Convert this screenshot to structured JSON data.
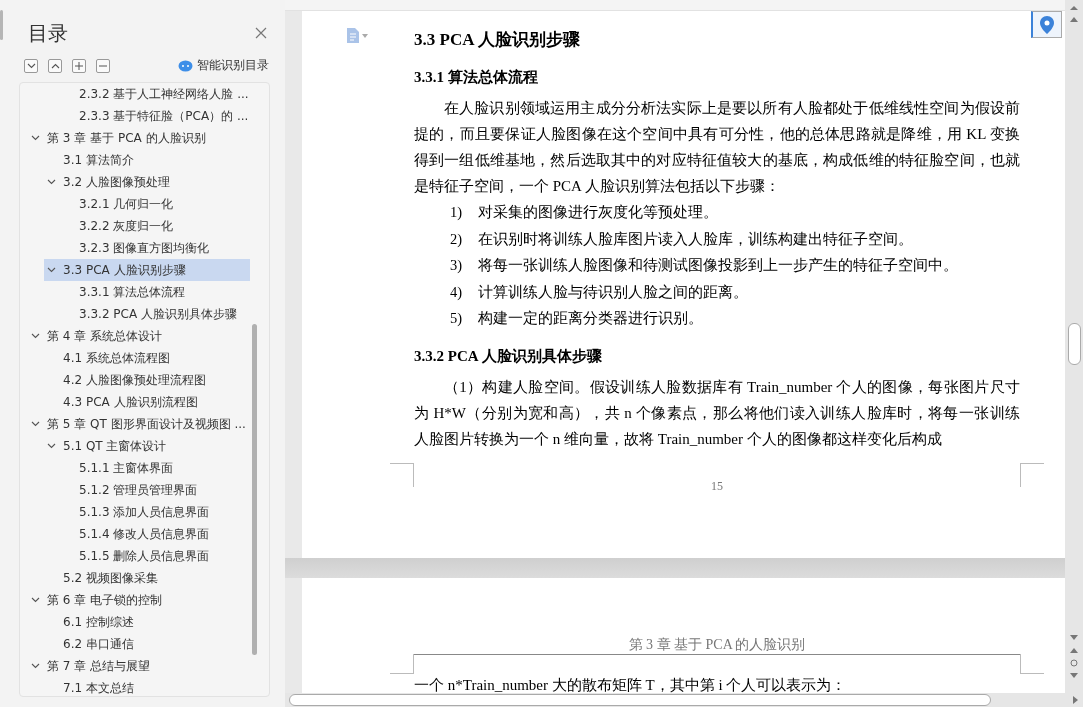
{
  "sidebar": {
    "title": "目录",
    "smart_toc_button": "智能识别目录",
    "toc": [
      {
        "children": [
          {
            "children": [
              {
                "label": "2.3.2  基于人工神经网络人脸 ...",
                "selected": false
              },
              {
                "label": "2.3.3  基于特征脸（PCA）的 ...",
                "selected": false
              }
            ]
          }
        ]
      },
      {
        "label": "第 3 章  基于 PCA 的人脸识别",
        "selected": false,
        "expanded": true,
        "children": [
          {
            "label": "3.1  算法简介",
            "selected": false
          },
          {
            "label": "3.2  人脸图像预处理",
            "selected": false,
            "expanded": true,
            "children": [
              {
                "label": "3.2.1  几何归一化",
                "selected": false
              },
              {
                "label": "3.2.2  灰度归一化",
                "selected": false
              },
              {
                "label": "3.2.3  图像直方图均衡化",
                "selected": false
              }
            ]
          },
          {
            "label": "3.3 PCA 人脸识别步骤",
            "selected": true,
            "expanded": true,
            "children": [
              {
                "label": "3.3.1  算法总体流程",
                "selected": false
              },
              {
                "label": "3.3.2 PCA 人脸识别具体步骤",
                "selected": false
              }
            ]
          }
        ]
      },
      {
        "label": "第 4 章  系统总体设计",
        "selected": false,
        "expanded": true,
        "children": [
          {
            "label": "4.1  系统总体流程图",
            "selected": false
          },
          {
            "label": "4.2  人脸图像预处理流程图",
            "selected": false
          },
          {
            "label": "4.3 PCA 人脸识别流程图",
            "selected": false
          }
        ]
      },
      {
        "label": "第 5 章  QT 图形界面设计及视频图 ...",
        "selected": false,
        "expanded": true,
        "children": [
          {
            "label": "5.1 QT 主窗体设计",
            "selected": false,
            "expanded": true,
            "children": [
              {
                "label": "5.1.1  主窗体界面",
                "selected": false
              },
              {
                "label": "5.1.2  管理员管理界面",
                "selected": false
              },
              {
                "label": "5.1.3  添加人员信息界面",
                "selected": false
              },
              {
                "label": "5.1.4  修改人员信息界面",
                "selected": false
              },
              {
                "label": "5.1.5  删除人员信息界面",
                "selected": false
              }
            ]
          },
          {
            "label": "5.2  视频图像采集",
            "selected": false
          }
        ]
      },
      {
        "label": "第 6 章  电子锁的控制",
        "selected": false,
        "expanded": true,
        "children": [
          {
            "label": "6.1  控制综述",
            "selected": false
          },
          {
            "label": "6.2  串口通信",
            "selected": false
          }
        ]
      },
      {
        "label": "第 7 章  总结与展望",
        "selected": false,
        "expanded": true,
        "children": [
          {
            "label": "7.1  本文总结",
            "selected": false
          }
        ]
      }
    ]
  },
  "document": {
    "page_1": {
      "heading": "3.3 PCA 人脸识别步骤",
      "subheading_1": "3.3.1  算法总体流程",
      "paragraph_1": "在人脸识别领域运用主成分分析法实际上是要以所有人脸都处于低维线性空间为假设前提的，而且要保证人脸图像在这个空间中具有可分性，他的总体思路就是降维，用 KL 变换得到一组低维基地，然后选取其中的对应特征值较大的基底，构成低维的特征脸空间，也就是特征子空间，一个 PCA 人脸识别算法包括以下步骤：",
      "steps": [
        {
          "number": "1)",
          "text": "对采集的图像进行灰度化等预处理。"
        },
        {
          "number": "2)",
          "text": "在识别时将训练人脸库图片读入人脸库，训练构建出特征子空间。"
        },
        {
          "number": "3)",
          "text": "将每一张训练人脸图像和待测试图像投影到上一步产生的特征子空间中。"
        },
        {
          "number": "4)",
          "text": "计算训练人脸与待识别人脸之间的距离。"
        },
        {
          "number": "5)",
          "text": "构建一定的距离分类器进行识别。"
        }
      ],
      "subheading_2": "3.3.2 PCA 人脸识别具体步骤",
      "paragraph_2": "（1）构建人脸空间。假设训练人脸数据库有 Train_number 个人的图像，每张图片尺寸为 H*W（分别为宽和高），共 n 个像素点，那么将他们读入训练人脸库时，将每一张训练人脸图片转换为一个 n 维向量，故将 Train_number 个人的图像都这样变化后构成",
      "page_number": "15"
    },
    "page_2": {
      "header": "第 3 章   基于 PCA 的人脸识别",
      "paragraph": "一个 n*Train_number 大的散布矩阵 T，其中第 i 个人可以表示为："
    }
  }
}
